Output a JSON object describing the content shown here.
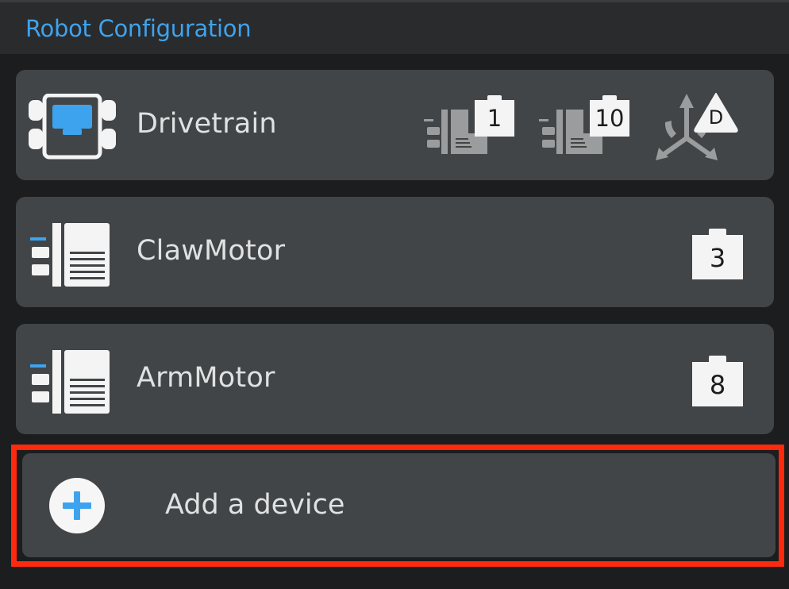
{
  "header": {
    "title": "Robot Configuration"
  },
  "devices": [
    {
      "name": "Drivetrain",
      "icon": "drivetrain-icon",
      "ports": [
        "1",
        "10"
      ],
      "gyro_label": "D"
    },
    {
      "name": "ClawMotor",
      "icon": "motor-icon",
      "ports": [
        "3"
      ]
    },
    {
      "name": "ArmMotor",
      "icon": "motor-icon",
      "ports": [
        "8"
      ]
    }
  ],
  "add_device": {
    "label": "Add a device",
    "icon": "plus-icon"
  },
  "colors": {
    "accent": "#3ea3ee",
    "card": "#424547",
    "background": "#1b1d1e",
    "highlight": "#ff2a0e"
  }
}
